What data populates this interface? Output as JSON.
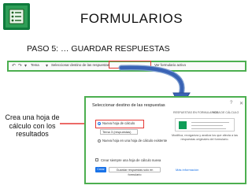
{
  "page": {
    "title": "FORMULARIOS",
    "step": "PASO 5: … GUARDAR RESPUESTAS",
    "caption": "Crea una hoja de cálculo con los resultados"
  },
  "toolbar": {
    "theme_label": "Tema",
    "destination_label": "Seleccionar destino de las respuestas",
    "live_form_label": "Ver formulario activo"
  },
  "dialog": {
    "title": "Seleccionar destino de las respuestas",
    "options": {
      "new_sheet": "Nueva hoja de cálculo",
      "sheet_name_value": "Tema 3 (respuestas)",
      "existing_sheet": "Nueva hoja en una hoja de cálculo existente"
    },
    "side_tabs": [
      "RESPUESTAS EN FORMULARIOS",
      "HOJA DE CÁLCULO"
    ],
    "side_desc": "Modifica, reorganiza y analiza los que afecta a las respuestas originales del formulario.",
    "checkbox_label": "Crear siempre una hoja de cálculo nueva",
    "create_button": "Crear",
    "save_in_form_button": "Guardar respuestas solo en formulario",
    "more_info_link": "Más información"
  },
  "colors": {
    "frame": "#4caf50",
    "highlight": "#e53935",
    "primary": "#1a73e8",
    "logo": "#0f9d58"
  }
}
